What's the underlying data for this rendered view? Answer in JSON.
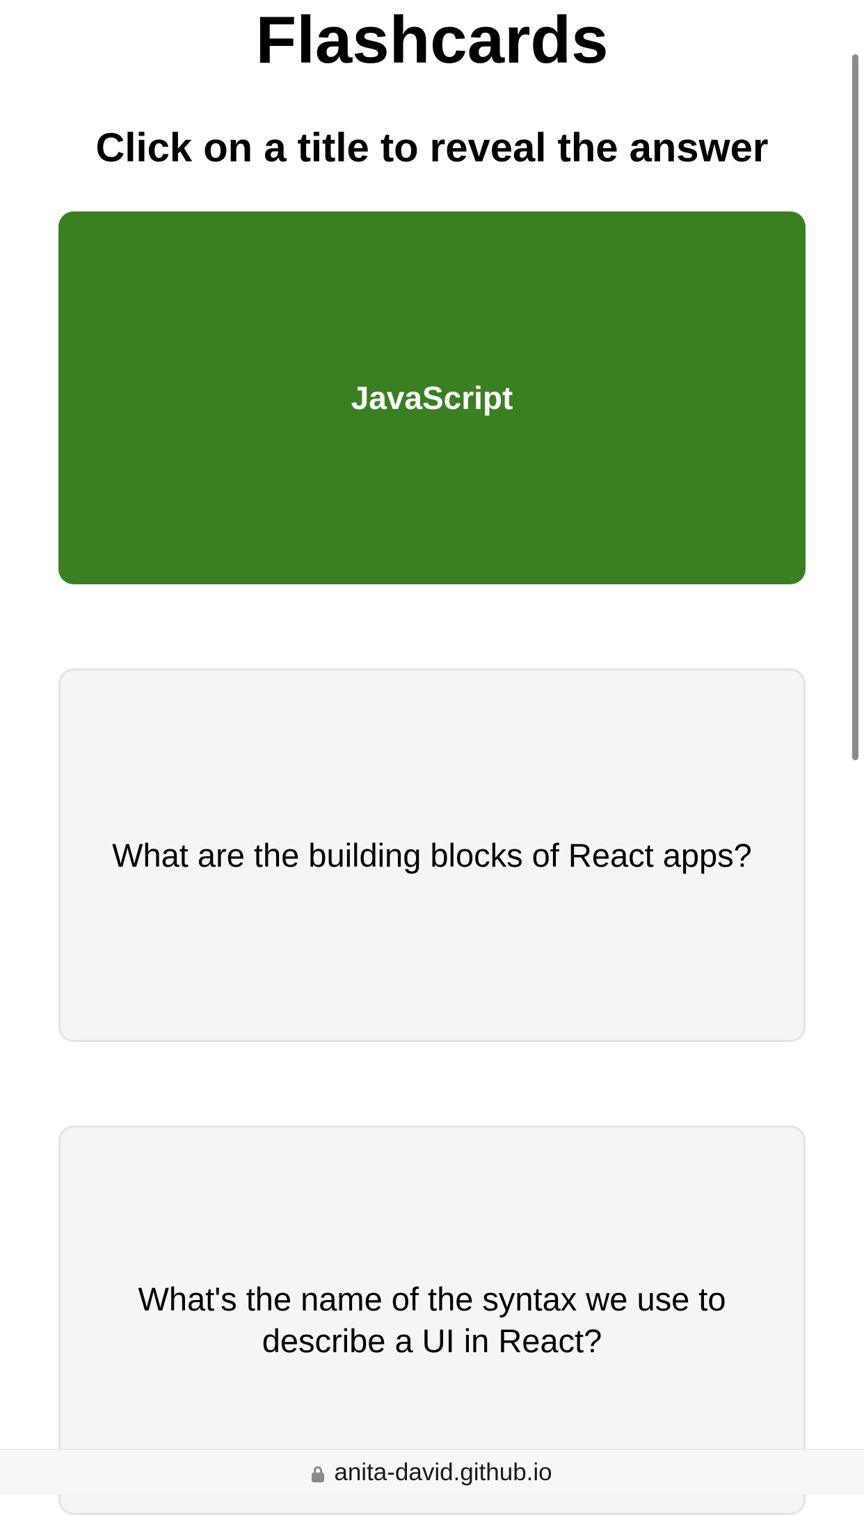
{
  "page": {
    "title": "Flashcards",
    "subtitle": "Click on a title to reveal the answer"
  },
  "cards": [
    {
      "text": "JavaScript",
      "state": "selected"
    },
    {
      "text": "What are the building blocks of React apps?",
      "state": "default"
    },
    {
      "text": "What's the name of the syntax we use to describe a UI in React?",
      "state": "default"
    }
  ],
  "browser": {
    "url": "anita-david.github.io",
    "lock_icon": "lock-icon"
  },
  "colors": {
    "selected_card": "#3a7f22",
    "default_card": "#f5f5f5"
  }
}
